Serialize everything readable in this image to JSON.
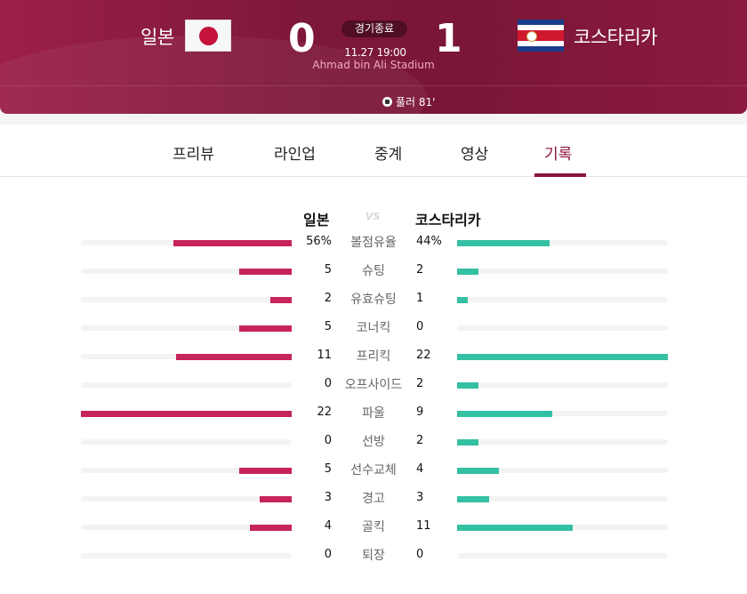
{
  "match": {
    "home": {
      "name": "일본",
      "score": "0",
      "flag": "japan-flag-icon"
    },
    "away": {
      "name": "코스타리카",
      "score": "1",
      "flag": "costa-rica-flag-icon"
    },
    "status": "경기종료",
    "datetime": "11.27 19:00",
    "stadium": "Ahmad bin Ali Stadium",
    "goal_event": "풀러 81'"
  },
  "tabs": [
    {
      "label": "프리뷰"
    },
    {
      "label": "라인업"
    },
    {
      "label": "중계"
    },
    {
      "label": "영상"
    },
    {
      "label": "기록",
      "active": true
    }
  ],
  "stats_header": {
    "home": "일본",
    "vs": "VS",
    "away": "코스타리카"
  },
  "stats": [
    {
      "label": "볼점유율",
      "home": "56%",
      "away": "44%",
      "home_ratio": 0.56,
      "away_ratio": 0.44
    },
    {
      "label": "슈팅",
      "home": "5",
      "away": "2",
      "home_ratio": 0.25,
      "away_ratio": 0.1
    },
    {
      "label": "유효슈팅",
      "home": "2",
      "away": "1",
      "home_ratio": 0.1,
      "away_ratio": 0.05
    },
    {
      "label": "코너킥",
      "home": "5",
      "away": "0",
      "home_ratio": 0.25,
      "away_ratio": 0.0
    },
    {
      "label": "프리킥",
      "home": "11",
      "away": "22",
      "home_ratio": 0.55,
      "away_ratio": 1.0
    },
    {
      "label": "오프사이드",
      "home": "0",
      "away": "2",
      "home_ratio": 0.0,
      "away_ratio": 0.1
    },
    {
      "label": "파울",
      "home": "22",
      "away": "9",
      "home_ratio": 1.0,
      "away_ratio": 0.45
    },
    {
      "label": "선방",
      "home": "0",
      "away": "2",
      "home_ratio": 0.0,
      "away_ratio": 0.1
    },
    {
      "label": "선수교체",
      "home": "5",
      "away": "4",
      "home_ratio": 0.25,
      "away_ratio": 0.2
    },
    {
      "label": "경고",
      "home": "3",
      "away": "3",
      "home_ratio": 0.15,
      "away_ratio": 0.15
    },
    {
      "label": "골킥",
      "home": "4",
      "away": "11",
      "home_ratio": 0.2,
      "away_ratio": 0.55
    },
    {
      "label": "퇴장",
      "home": "0",
      "away": "0",
      "home_ratio": 0.0,
      "away_ratio": 0.0
    }
  ],
  "colors": {
    "brand": "#8a1538",
    "home_bar": "#c7245b",
    "away_bar": "#34c0a3"
  }
}
